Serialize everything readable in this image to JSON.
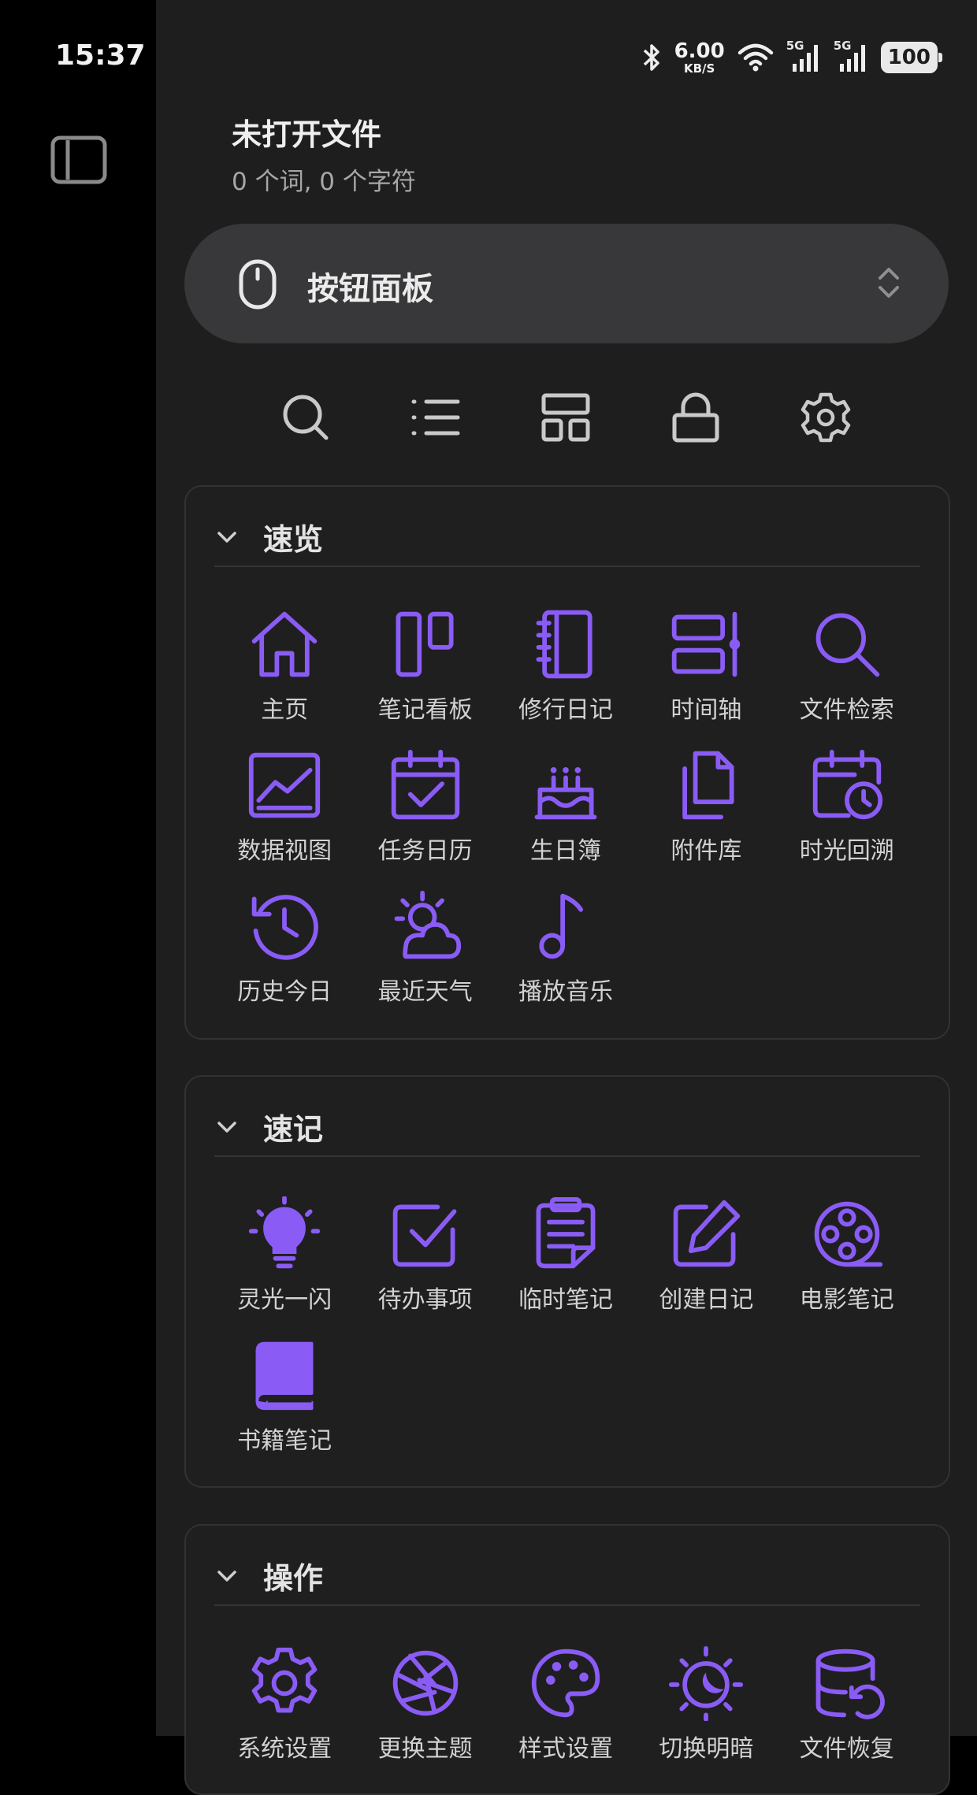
{
  "status_bar": {
    "time": "15:37",
    "speed_value": "6.00",
    "speed_unit": "KB/S",
    "battery": "100",
    "net1": "5G",
    "net2": "5G"
  },
  "header": {
    "title": "未打开文件",
    "stats": "0 个词, 0 个字符"
  },
  "panel_selector": {
    "label": "按钮面板"
  },
  "colors": {
    "accent": "#8a5cf5",
    "background": "#1e1e1f",
    "sidebar": "#000000"
  },
  "sections": [
    {
      "title": "速览",
      "items": [
        {
          "label": "主页",
          "icon": "home-icon"
        },
        {
          "label": "笔记看板",
          "icon": "kanban-icon"
        },
        {
          "label": "修行日记",
          "icon": "notebook-icon"
        },
        {
          "label": "时间轴",
          "icon": "timeline-icon"
        },
        {
          "label": "文件检索",
          "icon": "search-icon"
        },
        {
          "label": "数据视图",
          "icon": "chart-icon"
        },
        {
          "label": "任务日历",
          "icon": "calendar-check-icon"
        },
        {
          "label": "生日簿",
          "icon": "cake-icon"
        },
        {
          "label": "附件库",
          "icon": "files-icon"
        },
        {
          "label": "时光回溯",
          "icon": "calendar-clock-icon"
        },
        {
          "label": "历史今日",
          "icon": "history-icon"
        },
        {
          "label": "最近天气",
          "icon": "weather-icon"
        },
        {
          "label": "播放音乐",
          "icon": "music-icon"
        }
      ]
    },
    {
      "title": "速记",
      "items": [
        {
          "label": "灵光一闪",
          "icon": "lightbulb-icon"
        },
        {
          "label": "待办事项",
          "icon": "checkbox-icon"
        },
        {
          "label": "临时笔记",
          "icon": "clipboard-icon"
        },
        {
          "label": "创建日记",
          "icon": "edit-icon"
        },
        {
          "label": "电影笔记",
          "icon": "film-reel-icon"
        },
        {
          "label": "书籍笔记",
          "icon": "book-icon"
        }
      ]
    },
    {
      "title": "操作",
      "items": [
        {
          "label": "系统设置",
          "icon": "gear-icon"
        },
        {
          "label": "更换主题",
          "icon": "aperture-icon"
        },
        {
          "label": "样式设置",
          "icon": "palette-icon"
        },
        {
          "label": "切换明暗",
          "icon": "sun-moon-icon"
        },
        {
          "label": "文件恢复",
          "icon": "database-restore-icon"
        }
      ]
    }
  ]
}
